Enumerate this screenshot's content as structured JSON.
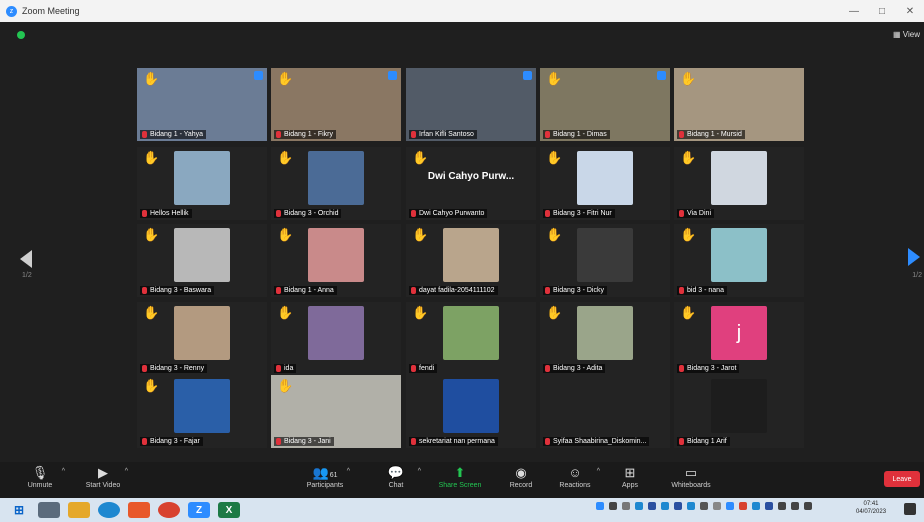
{
  "window": {
    "title": "Zoom Meeting",
    "view_label": "View",
    "minimize": "—",
    "maximize": "□",
    "close": "✕"
  },
  "pager": {
    "left": "1/2",
    "right": "1/2"
  },
  "tiles": [
    {
      "label": "Bidang 1 - Yahya",
      "video": true,
      "bg": "#6b7c95",
      "hand": true,
      "pinned": true
    },
    {
      "label": "Bidang 1 - Fikry",
      "video": true,
      "bg": "#8a7763",
      "hand": true,
      "pinned": true
    },
    {
      "label": "Irfan Kifli Santoso",
      "video": true,
      "bg": "#525b67",
      "hand": false,
      "pinned": true
    },
    {
      "label": "Bidang 1 - Dimas",
      "video": true,
      "bg": "#7e7761",
      "hand": true,
      "pinned": true
    },
    {
      "label": "Bidang 1 - Mursid",
      "video": true,
      "bg": "#a59680",
      "hand": true,
      "pinned": false
    },
    {
      "label": "Hellos Hellik",
      "thumb": "#8aa8c0",
      "hand": true
    },
    {
      "label": "Bidang 3 - Orchid",
      "thumb": "#4b6b96",
      "hand": true
    },
    {
      "label": "Dwi Cahyo Purwanto",
      "name": "Dwi Cahyo Purw...",
      "hand": true
    },
    {
      "label": "Bidang 3 - Fitri Nur",
      "thumb": "#c9d7e8",
      "hand": true
    },
    {
      "label": "Via Dini",
      "thumb": "#d0d7e0",
      "hand": true
    },
    {
      "label": "Bidang 3 - Baswara",
      "thumb": "#b8b8b8",
      "hand": true
    },
    {
      "label": "Bidang 1 - Anna",
      "thumb": "#c98a8a",
      "hand": true
    },
    {
      "label": "dayat fadila-2054111102",
      "thumb": "#b9a58c",
      "hand": true
    },
    {
      "label": "Bidang 3 - Dicky",
      "thumb": "#3a3a3a",
      "hand": true
    },
    {
      "label": "bid 3 - nana",
      "thumb": "#8cc0c8",
      "hand": true
    },
    {
      "label": "Bidang 3 - Renny",
      "thumb": "#b39a80",
      "hand": true
    },
    {
      "label": "ida",
      "thumb": "#7f6a9a",
      "hand": true
    },
    {
      "label": "fendi",
      "thumb": "#7da264",
      "hand": true
    },
    {
      "label": "Bidang 3 - Adita",
      "thumb": "#9aa58a",
      "hand": true
    },
    {
      "label": "Bidang 3 - Jarot",
      "thumb": "#e0407e",
      "thumb_text": "j",
      "hand": true
    },
    {
      "label": "Bidang 3 - Fajar",
      "thumb": "#2a5fa8",
      "hand": true
    },
    {
      "label": "Bidang 3 - Jani",
      "video": true,
      "bg": "#b1b0a8",
      "hand": true,
      "active": true
    },
    {
      "label": "sekretariat nan permana",
      "thumb": "#1f4ea0",
      "hand": false
    },
    {
      "label": "Syifaa Shaabirina_Diskomin...",
      "hand": false
    },
    {
      "label": "Bidang 1 Arif",
      "thumb": "#1d1d1d",
      "hand": false
    }
  ],
  "toolbar": {
    "unmute": "Unmute",
    "start_video": "Start Video",
    "participants": "Participants",
    "participants_count": "61",
    "chat": "Chat",
    "share_screen": "Share Screen",
    "record": "Record",
    "reactions": "Reactions",
    "apps": "Apps",
    "whiteboards": "Whiteboards",
    "leave": "Leave"
  },
  "taskbar": {
    "time": "07:41",
    "date": "04/07/2023"
  }
}
